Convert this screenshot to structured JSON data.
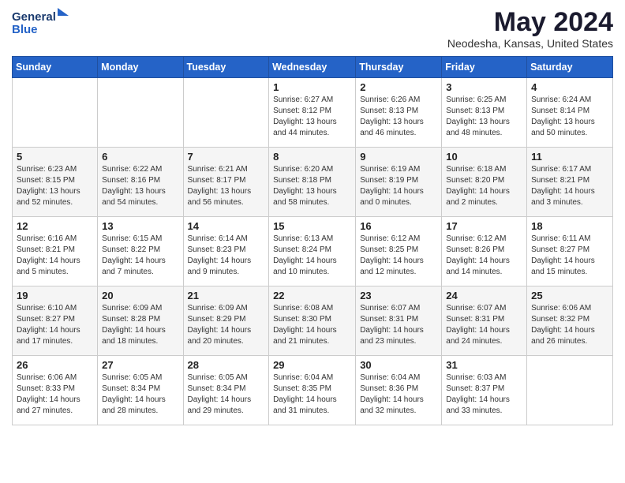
{
  "header": {
    "logo_line1": "General",
    "logo_line2": "Blue",
    "month": "May 2024",
    "location": "Neodesha, Kansas, United States"
  },
  "weekdays": [
    "Sunday",
    "Monday",
    "Tuesday",
    "Wednesday",
    "Thursday",
    "Friday",
    "Saturday"
  ],
  "weeks": [
    [
      {
        "day": "",
        "sunrise": "",
        "sunset": "",
        "daylight": ""
      },
      {
        "day": "",
        "sunrise": "",
        "sunset": "",
        "daylight": ""
      },
      {
        "day": "",
        "sunrise": "",
        "sunset": "",
        "daylight": ""
      },
      {
        "day": "1",
        "sunrise": "Sunrise: 6:27 AM",
        "sunset": "Sunset: 8:12 PM",
        "daylight": "Daylight: 13 hours and 44 minutes."
      },
      {
        "day": "2",
        "sunrise": "Sunrise: 6:26 AM",
        "sunset": "Sunset: 8:13 PM",
        "daylight": "Daylight: 13 hours and 46 minutes."
      },
      {
        "day": "3",
        "sunrise": "Sunrise: 6:25 AM",
        "sunset": "Sunset: 8:13 PM",
        "daylight": "Daylight: 13 hours and 48 minutes."
      },
      {
        "day": "4",
        "sunrise": "Sunrise: 6:24 AM",
        "sunset": "Sunset: 8:14 PM",
        "daylight": "Daylight: 13 hours and 50 minutes."
      }
    ],
    [
      {
        "day": "5",
        "sunrise": "Sunrise: 6:23 AM",
        "sunset": "Sunset: 8:15 PM",
        "daylight": "Daylight: 13 hours and 52 minutes."
      },
      {
        "day": "6",
        "sunrise": "Sunrise: 6:22 AM",
        "sunset": "Sunset: 8:16 PM",
        "daylight": "Daylight: 13 hours and 54 minutes."
      },
      {
        "day": "7",
        "sunrise": "Sunrise: 6:21 AM",
        "sunset": "Sunset: 8:17 PM",
        "daylight": "Daylight: 13 hours and 56 minutes."
      },
      {
        "day": "8",
        "sunrise": "Sunrise: 6:20 AM",
        "sunset": "Sunset: 8:18 PM",
        "daylight": "Daylight: 13 hours and 58 minutes."
      },
      {
        "day": "9",
        "sunrise": "Sunrise: 6:19 AM",
        "sunset": "Sunset: 8:19 PM",
        "daylight": "Daylight: 14 hours and 0 minutes."
      },
      {
        "day": "10",
        "sunrise": "Sunrise: 6:18 AM",
        "sunset": "Sunset: 8:20 PM",
        "daylight": "Daylight: 14 hours and 2 minutes."
      },
      {
        "day": "11",
        "sunrise": "Sunrise: 6:17 AM",
        "sunset": "Sunset: 8:21 PM",
        "daylight": "Daylight: 14 hours and 3 minutes."
      }
    ],
    [
      {
        "day": "12",
        "sunrise": "Sunrise: 6:16 AM",
        "sunset": "Sunset: 8:21 PM",
        "daylight": "Daylight: 14 hours and 5 minutes."
      },
      {
        "day": "13",
        "sunrise": "Sunrise: 6:15 AM",
        "sunset": "Sunset: 8:22 PM",
        "daylight": "Daylight: 14 hours and 7 minutes."
      },
      {
        "day": "14",
        "sunrise": "Sunrise: 6:14 AM",
        "sunset": "Sunset: 8:23 PM",
        "daylight": "Daylight: 14 hours and 9 minutes."
      },
      {
        "day": "15",
        "sunrise": "Sunrise: 6:13 AM",
        "sunset": "Sunset: 8:24 PM",
        "daylight": "Daylight: 14 hours and 10 minutes."
      },
      {
        "day": "16",
        "sunrise": "Sunrise: 6:12 AM",
        "sunset": "Sunset: 8:25 PM",
        "daylight": "Daylight: 14 hours and 12 minutes."
      },
      {
        "day": "17",
        "sunrise": "Sunrise: 6:12 AM",
        "sunset": "Sunset: 8:26 PM",
        "daylight": "Daylight: 14 hours and 14 minutes."
      },
      {
        "day": "18",
        "sunrise": "Sunrise: 6:11 AM",
        "sunset": "Sunset: 8:27 PM",
        "daylight": "Daylight: 14 hours and 15 minutes."
      }
    ],
    [
      {
        "day": "19",
        "sunrise": "Sunrise: 6:10 AM",
        "sunset": "Sunset: 8:27 PM",
        "daylight": "Daylight: 14 hours and 17 minutes."
      },
      {
        "day": "20",
        "sunrise": "Sunrise: 6:09 AM",
        "sunset": "Sunset: 8:28 PM",
        "daylight": "Daylight: 14 hours and 18 minutes."
      },
      {
        "day": "21",
        "sunrise": "Sunrise: 6:09 AM",
        "sunset": "Sunset: 8:29 PM",
        "daylight": "Daylight: 14 hours and 20 minutes."
      },
      {
        "day": "22",
        "sunrise": "Sunrise: 6:08 AM",
        "sunset": "Sunset: 8:30 PM",
        "daylight": "Daylight: 14 hours and 21 minutes."
      },
      {
        "day": "23",
        "sunrise": "Sunrise: 6:07 AM",
        "sunset": "Sunset: 8:31 PM",
        "daylight": "Daylight: 14 hours and 23 minutes."
      },
      {
        "day": "24",
        "sunrise": "Sunrise: 6:07 AM",
        "sunset": "Sunset: 8:31 PM",
        "daylight": "Daylight: 14 hours and 24 minutes."
      },
      {
        "day": "25",
        "sunrise": "Sunrise: 6:06 AM",
        "sunset": "Sunset: 8:32 PM",
        "daylight": "Daylight: 14 hours and 26 minutes."
      }
    ],
    [
      {
        "day": "26",
        "sunrise": "Sunrise: 6:06 AM",
        "sunset": "Sunset: 8:33 PM",
        "daylight": "Daylight: 14 hours and 27 minutes."
      },
      {
        "day": "27",
        "sunrise": "Sunrise: 6:05 AM",
        "sunset": "Sunset: 8:34 PM",
        "daylight": "Daylight: 14 hours and 28 minutes."
      },
      {
        "day": "28",
        "sunrise": "Sunrise: 6:05 AM",
        "sunset": "Sunset: 8:34 PM",
        "daylight": "Daylight: 14 hours and 29 minutes."
      },
      {
        "day": "29",
        "sunrise": "Sunrise: 6:04 AM",
        "sunset": "Sunset: 8:35 PM",
        "daylight": "Daylight: 14 hours and 31 minutes."
      },
      {
        "day": "30",
        "sunrise": "Sunrise: 6:04 AM",
        "sunset": "Sunset: 8:36 PM",
        "daylight": "Daylight: 14 hours and 32 minutes."
      },
      {
        "day": "31",
        "sunrise": "Sunrise: 6:03 AM",
        "sunset": "Sunset: 8:37 PM",
        "daylight": "Daylight: 14 hours and 33 minutes."
      },
      {
        "day": "",
        "sunrise": "",
        "sunset": "",
        "daylight": ""
      }
    ]
  ]
}
